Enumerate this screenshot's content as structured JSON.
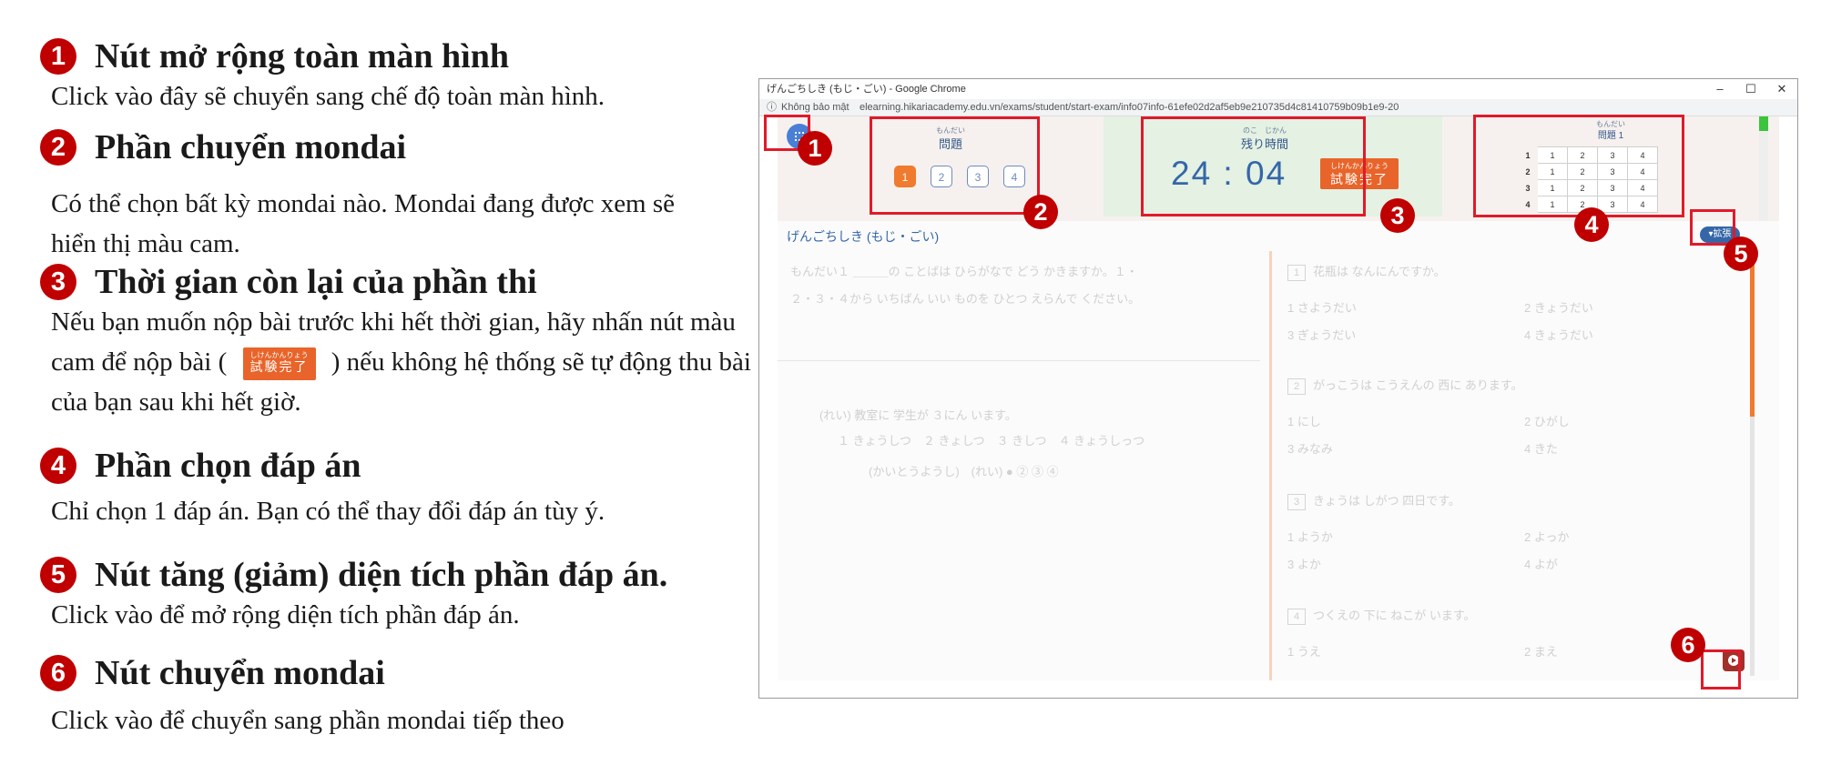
{
  "guide": {
    "sections": [
      {
        "num": "1",
        "title": "Nút mở rộng toàn màn hình",
        "desc": "Click vào đây sẽ chuyển sang chế độ toàn màn hình."
      },
      {
        "num": "2",
        "title": "Phần chuyển mondai",
        "desc": "Có thể chọn bất kỳ mondai nào. Mondai đang được xem sẽ hiển thị màu cam."
      },
      {
        "num": "3",
        "title": "Thời gian còn lại của phần thi",
        "desc_before": "Nếu bạn muốn nộp bài trước khi hết thời gian, hãy nhấn nút màu cam để nộp bài (",
        "desc_after": ") nếu không hệ thống sẽ tự động thu bài của bạn sau khi hết giờ."
      },
      {
        "num": "4",
        "title": "Phần chọn đáp án",
        "desc": "Chỉ chọn 1 đáp án. Bạn có thể thay đổi đáp án tùy ý."
      },
      {
        "num": "5",
        "title": "Nút tăng (giảm) diện tích phần đáp án.",
        "desc": "Click vào để mở rộng diện tích phần đáp án."
      },
      {
        "num": "6",
        "title": "Nút chuyển mondai",
        "desc": "Click vào để chuyển sang phần mondai tiếp theo"
      }
    ]
  },
  "screenshot": {
    "window_title": "げんごちしき (もじ・ごい) - Google Chrome",
    "security": "Không bảo mật",
    "url": "elearning.hikariacademy.edu.vn/exams/student/start-exam/info07info-61efe02d2af5eb9e210735d4c81410759b09b1e9-20",
    "win_min": "–",
    "win_max": "☐",
    "win_close": "✕",
    "mondai_furigana": "もんだい",
    "mondai_label": "問題",
    "mondai_buttons": [
      "1",
      "2",
      "3",
      "4"
    ],
    "active_mondai": "1",
    "time_furigana": "のこ　じかん",
    "time_label": "残り時間",
    "timer": "24 : 04",
    "submit_furigana": "しけんかんりょう",
    "submit_label": "試験完了",
    "grid_furigana": "もんだい",
    "grid_label": "問題 1",
    "answer_grid": [
      {
        "row": "1",
        "choices": [
          "1",
          "2",
          "3",
          "4"
        ]
      },
      {
        "row": "2",
        "choices": [
          "1",
          "2",
          "3",
          "4"
        ]
      },
      {
        "row": "3",
        "choices": [
          "1",
          "2",
          "3",
          "4"
        ]
      },
      {
        "row": "4",
        "choices": [
          "1",
          "2",
          "3",
          "4"
        ]
      }
    ],
    "section_title": "げんごちしき (もじ・ごい)",
    "expand_label": "拡張",
    "question_intro_line1": "もんだい１ ＿＿＿の ことばは ひらがなで どう かきますか。１・",
    "question_intro_line2": "２・３・４から いちばん いい ものを ひとつ えらんで ください。",
    "example_line1": "(れい) 教室に 学生が ３にん います。",
    "example_options": "１ きょうしつ　２ きょしつ　３ きしつ　４ きょうしっつ",
    "example_answer": "(かいとうようし)　(れい) ● ② ③ ④",
    "questions": [
      {
        "no": "1",
        "text": "花瓶は なんにんですか。",
        "opts": [
          "1 さようだい",
          "2 きょうだい",
          "3 ぎょうだい",
          "4 きょうだい"
        ]
      },
      {
        "no": "2",
        "text": "がっこうは こうえんの 西に あります。",
        "opts": [
          "1 にし",
          "2 ひがし",
          "3 みなみ",
          "4 きた"
        ]
      },
      {
        "no": "3",
        "text": "きょうは しがつ 四日です。",
        "opts": [
          "1 ようか",
          "2 よっか",
          "3 よか",
          "4 よが"
        ]
      },
      {
        "no": "4",
        "text": "つくえの 下に ねこが います。",
        "opts": [
          "1 うえ",
          "2 まえ"
        ]
      }
    ]
  },
  "markers": [
    "1",
    "2",
    "3",
    "4",
    "5",
    "6"
  ],
  "colors": {
    "marker_red": "#c00000",
    "highlight_red": "#e01a2a",
    "accent_orange": "#f07a2e",
    "timer_blue": "#3567a8"
  }
}
